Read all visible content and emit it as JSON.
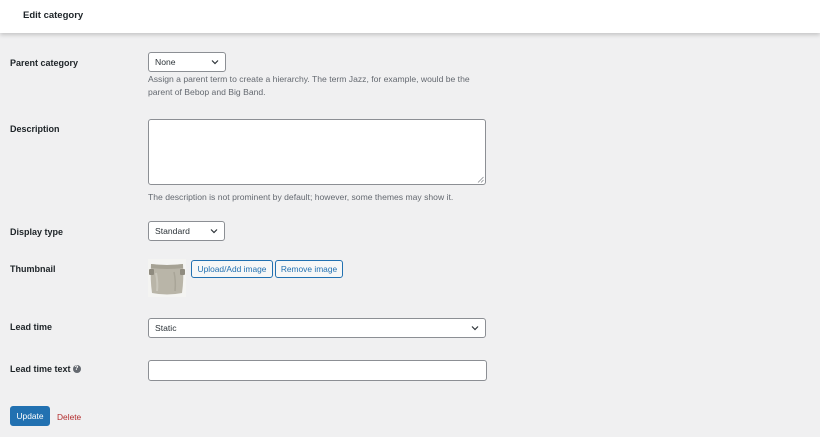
{
  "header": {
    "title": "Edit category"
  },
  "form": {
    "parent": {
      "label": "Parent category",
      "selected": "None",
      "help": "Assign a parent term to create a hierarchy. The term Jazz, for example, would be the parent of Bebop and Big Band."
    },
    "description": {
      "label": "Description",
      "value": "",
      "help": "The description is not prominent by default; however, some themes may show it."
    },
    "display_type": {
      "label": "Display type",
      "selected": "Standard"
    },
    "thumbnail": {
      "label": "Thumbnail",
      "upload_label": "Upload/Add image",
      "remove_label": "Remove image"
    },
    "lead_time": {
      "label": "Lead time",
      "selected": "Static"
    },
    "lead_time_text": {
      "label": "Lead time text",
      "help_icon": "?",
      "value": ""
    }
  },
  "actions": {
    "update_label": "Update",
    "delete_label": "Delete"
  },
  "colors": {
    "accent": "#2271b1",
    "danger": "#b32d2e",
    "background": "#f0f0f1"
  }
}
